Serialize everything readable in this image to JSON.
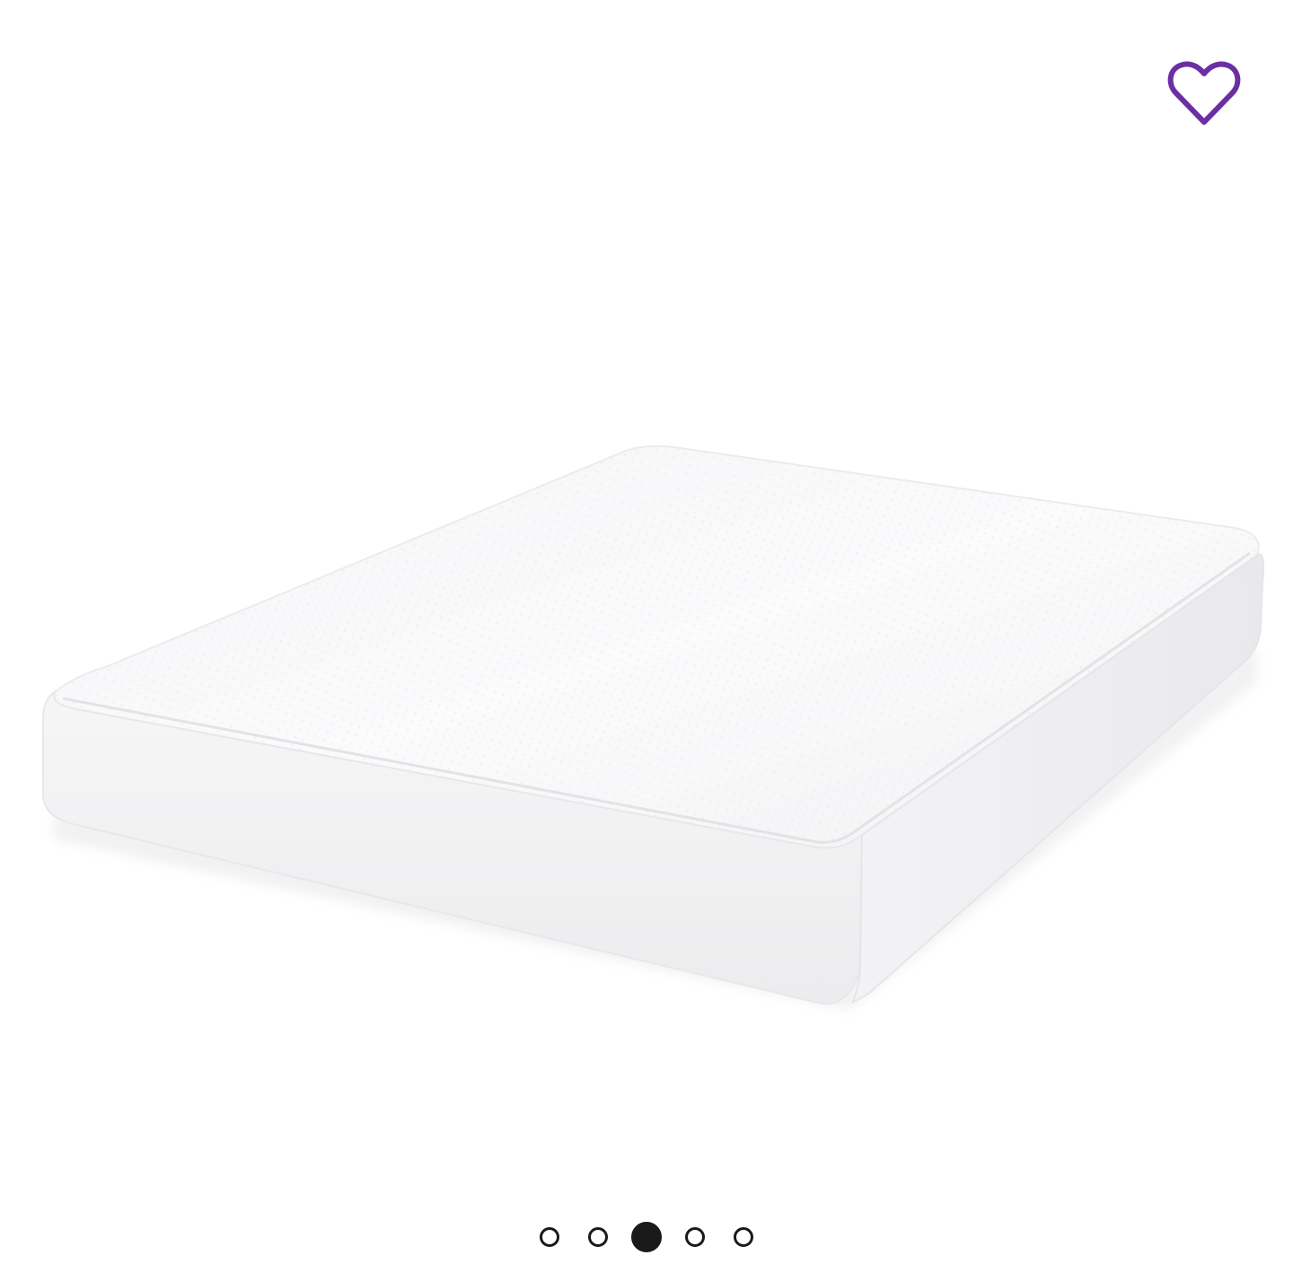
{
  "product_gallery": {
    "image": {
      "subject": "mattress",
      "alt": ""
    },
    "favorite": {
      "icon": "heart-outline-icon",
      "color": "#6b2fa3",
      "label": ""
    },
    "pagination": {
      "total": 5,
      "active_index": 2,
      "dots": [
        {
          "state": "inactive"
        },
        {
          "state": "inactive"
        },
        {
          "state": "active"
        },
        {
          "state": "inactive"
        },
        {
          "state": "inactive"
        }
      ]
    }
  }
}
